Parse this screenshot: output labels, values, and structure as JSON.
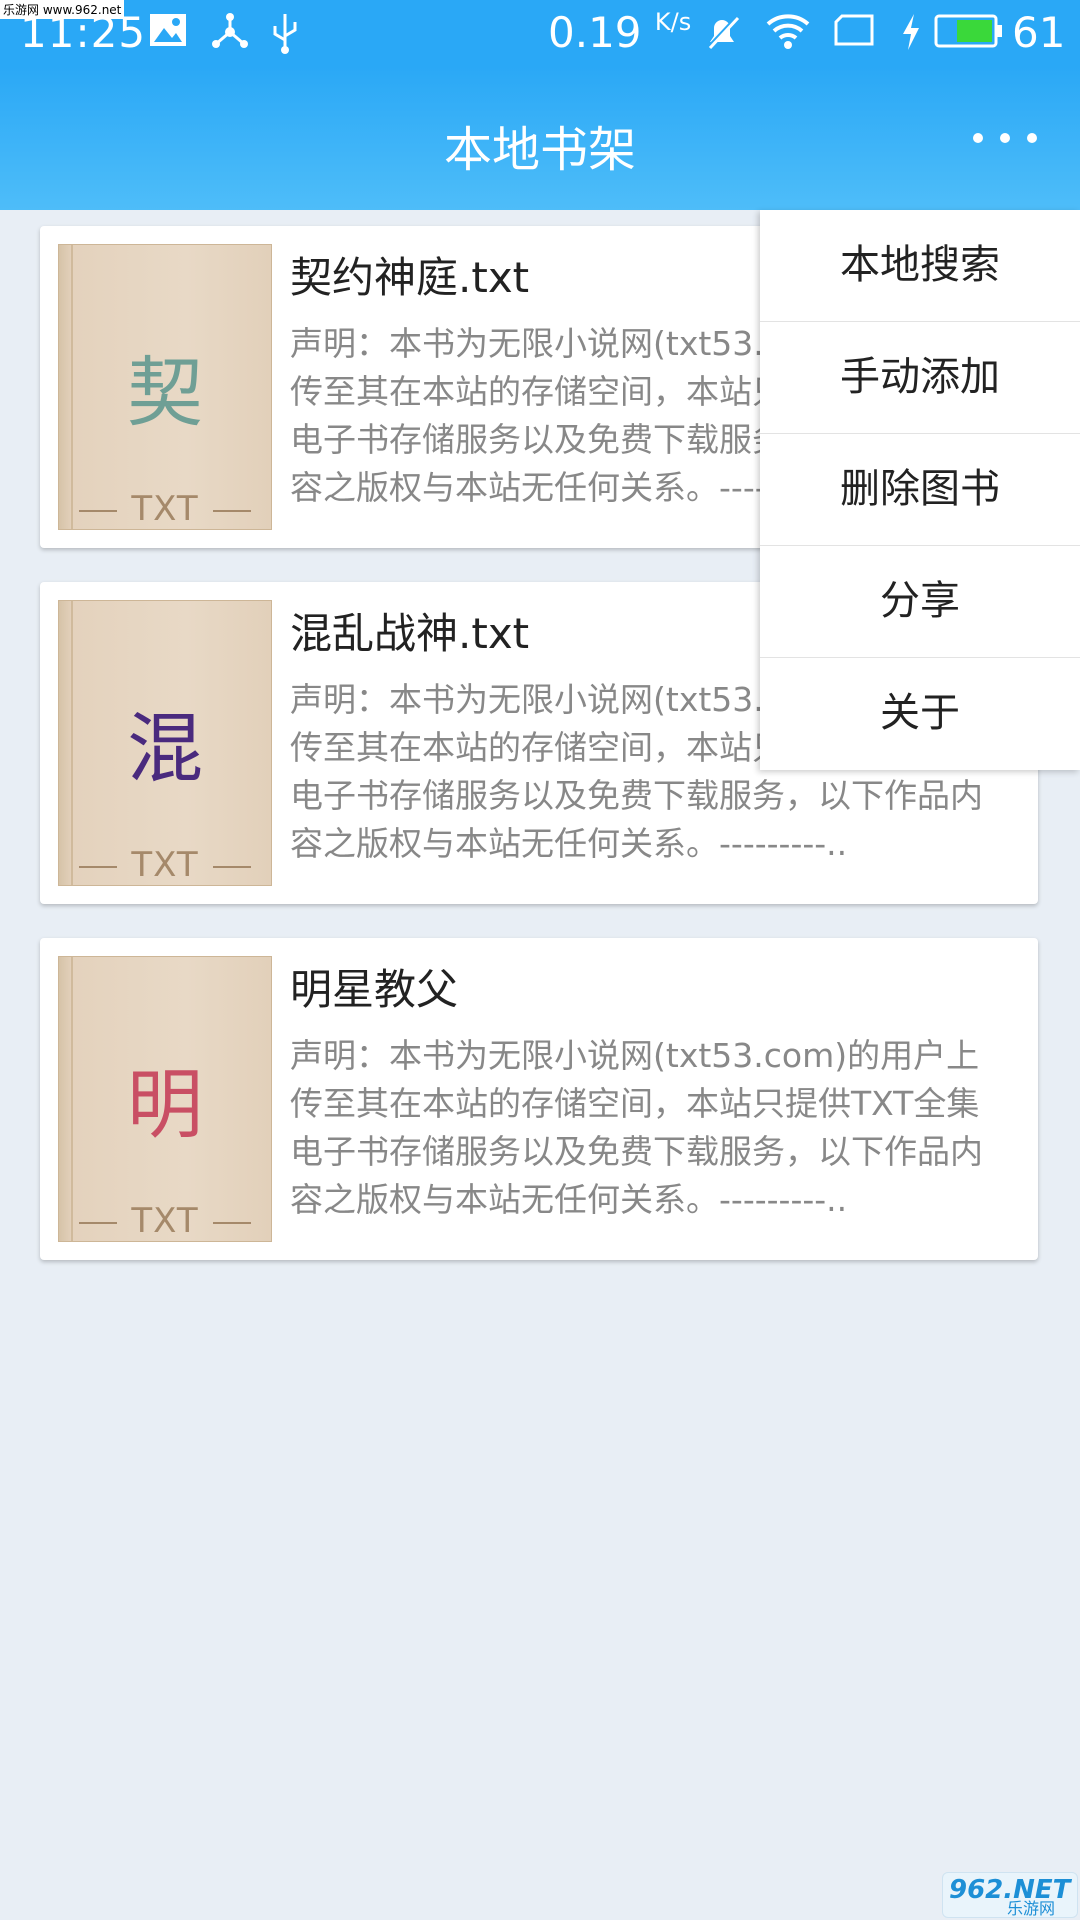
{
  "statusbar": {
    "watermark": "乐游网 www.962.net",
    "time": "11:25",
    "speed": "0.19",
    "speed_unit": "K/s",
    "battery": "61",
    "icons": [
      "image-icon",
      "share-hub-icon",
      "usb-icon",
      "mute-icon",
      "wifi-icon",
      "sim-icon",
      "charging-icon",
      "battery-icon"
    ],
    "battery_color": "#3ad83a"
  },
  "toolbar": {
    "title": "本地书架",
    "more_icon": "more-dots-icon"
  },
  "books": [
    {
      "cover_char": "契",
      "cover_char_color": "#6f9f95",
      "cover_label": "TXT",
      "title": "契约神庭.txt",
      "desc": "声明：本书为无限小说网(txt53.com)的用户上传至其在本站的存储空间，本站只提供TXT全集电子书存储服务以及免费下载服务，以下作品内容之版权与本站无任何关系。---------.."
    },
    {
      "cover_char": "混",
      "cover_char_color": "#4a2a7e",
      "cover_label": "TXT",
      "title": "混乱战神.txt",
      "desc": "声明：本书为无限小说网(txt53.com)的用户上传至其在本站的存储空间，本站只提供TXT全集电子书存储服务以及免费下载服务，以下作品内容之版权与本站无任何关系。---------.."
    },
    {
      "cover_char": "明",
      "cover_char_color": "#c94f64",
      "cover_label": "TXT",
      "title": "明星教父",
      "desc": "声明：本书为无限小说网(txt53.com)的用户上传至其在本站的存储空间，本站只提供TXT全集电子书存储服务以及免费下载服务，以下作品内容之版权与本站无任何关系。---------.."
    }
  ],
  "menu": {
    "items": [
      "本地搜索",
      "手动添加",
      "删除图书",
      "分享",
      "关于"
    ]
  },
  "logo": {
    "brand": "962.NET",
    "sub": "乐游网"
  }
}
